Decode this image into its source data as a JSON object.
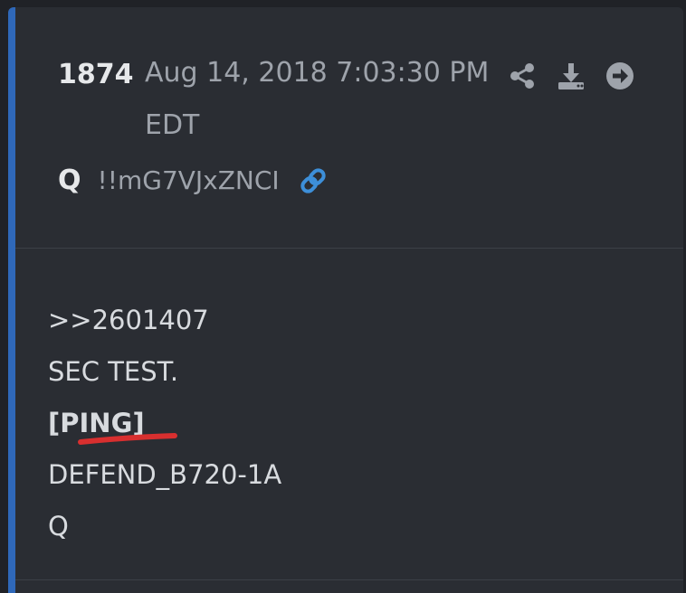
{
  "post": {
    "number": "1874",
    "timestamp": "Aug 14, 2018 7:03:30 PM EDT",
    "author": "Q",
    "tripcode": "!!mG7VJxZNCI",
    "body_lines": [
      ">>2601407",
      "SEC TEST.",
      "[PING]",
      "DEFEND_B720-1A",
      "Q"
    ]
  },
  "icons": {
    "share": "share-icon",
    "download": "download-icon",
    "open": "arrow-right-circle-icon",
    "link": "link-icon"
  },
  "colors": {
    "accent_border": "#2f68b9",
    "link_icon": "#3d8fd9",
    "underline_mark": "#d82f2f",
    "card_background": "#2a2d33"
  }
}
